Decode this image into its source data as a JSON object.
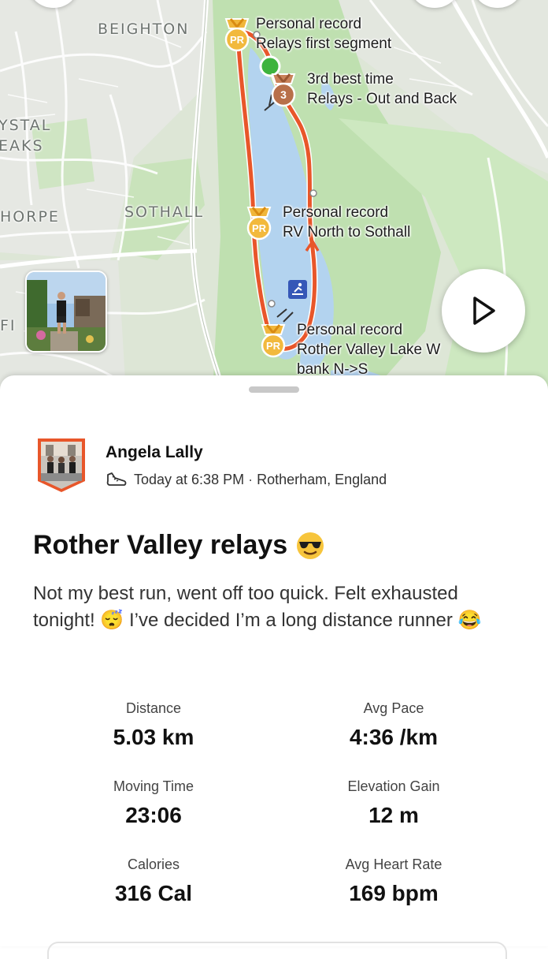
{
  "map": {
    "places": [
      "BEIGHTON",
      "YSTAL",
      "EAKS",
      "HORPE",
      "SOTHALL",
      "FI"
    ],
    "achievements": [
      {
        "type": "Personal record",
        "segment": "Relays first segment",
        "badge": "PR"
      },
      {
        "type": "3rd best time",
        "segment": "Relays - Out and Back",
        "badge": "3"
      },
      {
        "type": "Personal record",
        "segment": "RV North to Sothall",
        "badge": "PR"
      },
      {
        "type": "Personal record",
        "segment": "Rother Valley Lake W",
        "segment2": "bank N->S",
        "badge": "PR"
      }
    ],
    "route_color": "#e8562a",
    "water_color": "#b3d3ef",
    "icons": [
      "play-icon",
      "pr-medal-icon",
      "bronze-medal-icon",
      "watersports-icon"
    ]
  },
  "activity": {
    "athlete": "Angela Lally",
    "time": "Today at 6:38 PM",
    "separator": " · ",
    "location": "Rotherham, England",
    "title": "Rother Valley relays",
    "description": "Not my best run, went off too quick. Felt exhausted tonight! 😴 I’ve decided I’m a long distance runner 😂"
  },
  "stats": {
    "distance": {
      "label": "Distance",
      "value": "5.03 km"
    },
    "pace": {
      "label": "Avg Pace",
      "value": "4:36 /km"
    },
    "moving_time": {
      "label": "Moving Time",
      "value": "23:06"
    },
    "elevation": {
      "label": "Elevation Gain",
      "value": "12 m"
    },
    "calories": {
      "label": "Calories",
      "value": "316 Cal"
    },
    "heart_rate": {
      "label": "Avg Heart Rate",
      "value": "169 bpm"
    }
  }
}
